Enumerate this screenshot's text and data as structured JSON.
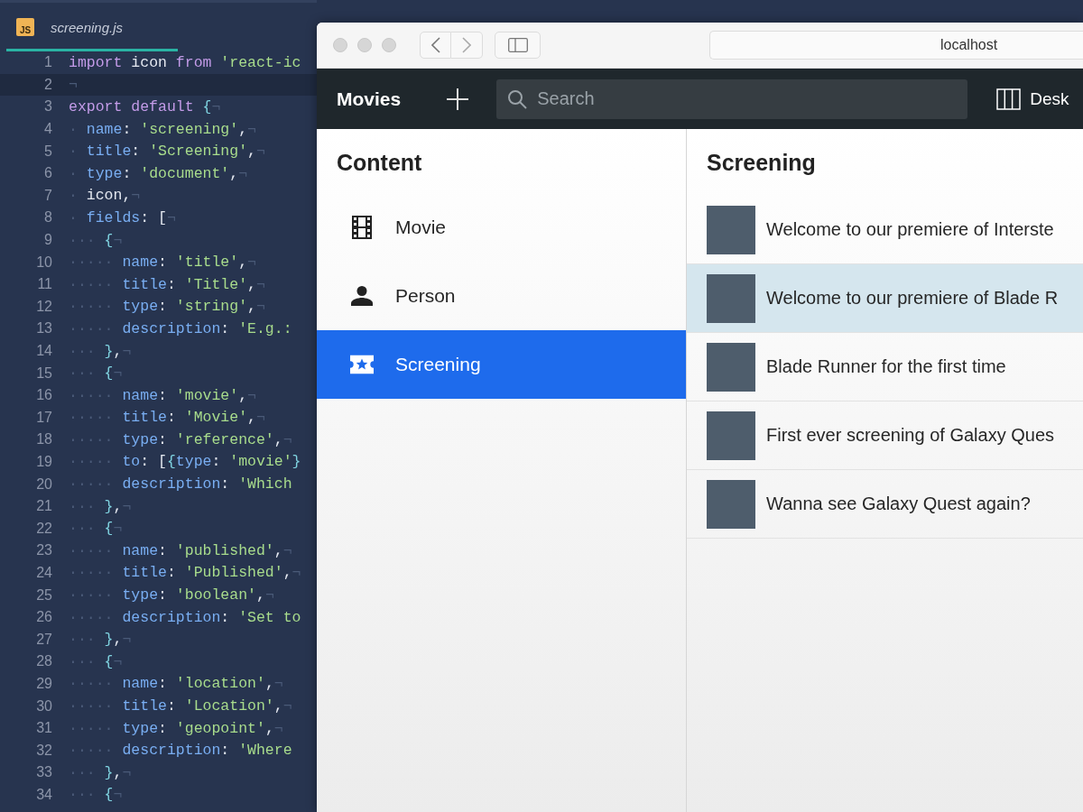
{
  "editor": {
    "tab": {
      "badge": "JS",
      "filename": "screening.js",
      "selected": true
    },
    "lines": [
      {
        "number": "1",
        "current": false,
        "tokens": [
          {
            "kind": "keyword",
            "text": "import"
          },
          {
            "kind": "plain",
            "text": " icon "
          },
          {
            "kind": "keyword",
            "text": "from"
          },
          {
            "kind": "string",
            "text": " 'react-ic"
          }
        ]
      },
      {
        "number": "2",
        "current": true,
        "tokens": [
          {
            "kind": "mark",
            "text": "¬"
          }
        ]
      },
      {
        "number": "3",
        "current": false,
        "tokens": [
          {
            "kind": "keyword",
            "text": "export default"
          },
          {
            "kind": "punct",
            "text": " {"
          },
          {
            "kind": "mark",
            "text": "¬"
          }
        ]
      },
      {
        "number": "4",
        "current": false,
        "tokens": [
          {
            "kind": "mark",
            "text": "· "
          },
          {
            "kind": "property",
            "text": "name"
          },
          {
            "kind": "plain",
            "text": ": "
          },
          {
            "kind": "string",
            "text": "'screening'"
          },
          {
            "kind": "plain",
            "text": ","
          },
          {
            "kind": "mark",
            "text": "¬"
          }
        ]
      },
      {
        "number": "5",
        "current": false,
        "tokens": [
          {
            "kind": "mark",
            "text": "· "
          },
          {
            "kind": "property",
            "text": "title"
          },
          {
            "kind": "plain",
            "text": ": "
          },
          {
            "kind": "string",
            "text": "'Screening'"
          },
          {
            "kind": "plain",
            "text": ","
          },
          {
            "kind": "mark",
            "text": "¬"
          }
        ]
      },
      {
        "number": "6",
        "current": false,
        "tokens": [
          {
            "kind": "mark",
            "text": "· "
          },
          {
            "kind": "property",
            "text": "type"
          },
          {
            "kind": "plain",
            "text": ": "
          },
          {
            "kind": "string",
            "text": "'document'"
          },
          {
            "kind": "plain",
            "text": ","
          },
          {
            "kind": "mark",
            "text": "¬"
          }
        ]
      },
      {
        "number": "7",
        "current": false,
        "tokens": [
          {
            "kind": "mark",
            "text": "· "
          },
          {
            "kind": "plain",
            "text": "icon,"
          },
          {
            "kind": "mark",
            "text": "¬"
          }
        ]
      },
      {
        "number": "8",
        "current": false,
        "tokens": [
          {
            "kind": "mark",
            "text": "· "
          },
          {
            "kind": "property",
            "text": "fields"
          },
          {
            "kind": "plain",
            "text": ": ["
          },
          {
            "kind": "mark",
            "text": "¬"
          }
        ]
      },
      {
        "number": "9",
        "current": false,
        "tokens": [
          {
            "kind": "mark",
            "text": "··· "
          },
          {
            "kind": "punct",
            "text": "{"
          },
          {
            "kind": "mark",
            "text": "¬"
          }
        ]
      },
      {
        "number": "10",
        "current": false,
        "tokens": [
          {
            "kind": "mark",
            "text": "····· "
          },
          {
            "kind": "property",
            "text": "name"
          },
          {
            "kind": "plain",
            "text": ": "
          },
          {
            "kind": "string",
            "text": "'title'"
          },
          {
            "kind": "plain",
            "text": ","
          },
          {
            "kind": "mark",
            "text": "¬"
          }
        ]
      },
      {
        "number": "11",
        "current": false,
        "tokens": [
          {
            "kind": "mark",
            "text": "····· "
          },
          {
            "kind": "property",
            "text": "title"
          },
          {
            "kind": "plain",
            "text": ": "
          },
          {
            "kind": "string",
            "text": "'Title'"
          },
          {
            "kind": "plain",
            "text": ","
          },
          {
            "kind": "mark",
            "text": "¬"
          }
        ]
      },
      {
        "number": "12",
        "current": false,
        "tokens": [
          {
            "kind": "mark",
            "text": "····· "
          },
          {
            "kind": "property",
            "text": "type"
          },
          {
            "kind": "plain",
            "text": ": "
          },
          {
            "kind": "string",
            "text": "'string'"
          },
          {
            "kind": "plain",
            "text": ","
          },
          {
            "kind": "mark",
            "text": "¬"
          }
        ]
      },
      {
        "number": "13",
        "current": false,
        "tokens": [
          {
            "kind": "mark",
            "text": "····· "
          },
          {
            "kind": "property",
            "text": "description"
          },
          {
            "kind": "plain",
            "text": ": "
          },
          {
            "kind": "string",
            "text": "'E.g.:"
          }
        ]
      },
      {
        "number": "14",
        "current": false,
        "tokens": [
          {
            "kind": "mark",
            "text": "··· "
          },
          {
            "kind": "punct",
            "text": "}"
          },
          {
            "kind": "plain",
            "text": ","
          },
          {
            "kind": "mark",
            "text": "¬"
          }
        ]
      },
      {
        "number": "15",
        "current": false,
        "tokens": [
          {
            "kind": "mark",
            "text": "··· "
          },
          {
            "kind": "punct",
            "text": "{"
          },
          {
            "kind": "mark",
            "text": "¬"
          }
        ]
      },
      {
        "number": "16",
        "current": false,
        "tokens": [
          {
            "kind": "mark",
            "text": "····· "
          },
          {
            "kind": "property",
            "text": "name"
          },
          {
            "kind": "plain",
            "text": ": "
          },
          {
            "kind": "string",
            "text": "'movie'"
          },
          {
            "kind": "plain",
            "text": ","
          },
          {
            "kind": "mark",
            "text": "¬"
          }
        ]
      },
      {
        "number": "17",
        "current": false,
        "tokens": [
          {
            "kind": "mark",
            "text": "····· "
          },
          {
            "kind": "property",
            "text": "title"
          },
          {
            "kind": "plain",
            "text": ": "
          },
          {
            "kind": "string",
            "text": "'Movie'"
          },
          {
            "kind": "plain",
            "text": ","
          },
          {
            "kind": "mark",
            "text": "¬"
          }
        ]
      },
      {
        "number": "18",
        "current": false,
        "tokens": [
          {
            "kind": "mark",
            "text": "····· "
          },
          {
            "kind": "property",
            "text": "type"
          },
          {
            "kind": "plain",
            "text": ": "
          },
          {
            "kind": "string",
            "text": "'reference'"
          },
          {
            "kind": "plain",
            "text": ","
          },
          {
            "kind": "mark",
            "text": "¬"
          }
        ]
      },
      {
        "number": "19",
        "current": false,
        "tokens": [
          {
            "kind": "mark",
            "text": "····· "
          },
          {
            "kind": "property",
            "text": "to"
          },
          {
            "kind": "plain",
            "text": ": ["
          },
          {
            "kind": "punct",
            "text": "{"
          },
          {
            "kind": "property",
            "text": "type"
          },
          {
            "kind": "plain",
            "text": ": "
          },
          {
            "kind": "string",
            "text": "'movie'"
          },
          {
            "kind": "punct",
            "text": "}"
          }
        ]
      },
      {
        "number": "20",
        "current": false,
        "tokens": [
          {
            "kind": "mark",
            "text": "····· "
          },
          {
            "kind": "property",
            "text": "description"
          },
          {
            "kind": "plain",
            "text": ": "
          },
          {
            "kind": "string",
            "text": "'Which"
          }
        ]
      },
      {
        "number": "21",
        "current": false,
        "tokens": [
          {
            "kind": "mark",
            "text": "··· "
          },
          {
            "kind": "punct",
            "text": "}"
          },
          {
            "kind": "plain",
            "text": ","
          },
          {
            "kind": "mark",
            "text": "¬"
          }
        ]
      },
      {
        "number": "22",
        "current": false,
        "tokens": [
          {
            "kind": "mark",
            "text": "··· "
          },
          {
            "kind": "punct",
            "text": "{"
          },
          {
            "kind": "mark",
            "text": "¬"
          }
        ]
      },
      {
        "number": "23",
        "current": false,
        "tokens": [
          {
            "kind": "mark",
            "text": "····· "
          },
          {
            "kind": "property",
            "text": "name"
          },
          {
            "kind": "plain",
            "text": ": "
          },
          {
            "kind": "string",
            "text": "'published'"
          },
          {
            "kind": "plain",
            "text": ","
          },
          {
            "kind": "mark",
            "text": "¬"
          }
        ]
      },
      {
        "number": "24",
        "current": false,
        "tokens": [
          {
            "kind": "mark",
            "text": "····· "
          },
          {
            "kind": "property",
            "text": "title"
          },
          {
            "kind": "plain",
            "text": ": "
          },
          {
            "kind": "string",
            "text": "'Published'"
          },
          {
            "kind": "plain",
            "text": ","
          },
          {
            "kind": "mark",
            "text": "¬"
          }
        ]
      },
      {
        "number": "25",
        "current": false,
        "tokens": [
          {
            "kind": "mark",
            "text": "····· "
          },
          {
            "kind": "property",
            "text": "type"
          },
          {
            "kind": "plain",
            "text": ": "
          },
          {
            "kind": "string",
            "text": "'boolean'"
          },
          {
            "kind": "plain",
            "text": ","
          },
          {
            "kind": "mark",
            "text": "¬"
          }
        ]
      },
      {
        "number": "26",
        "current": false,
        "tokens": [
          {
            "kind": "mark",
            "text": "····· "
          },
          {
            "kind": "property",
            "text": "description"
          },
          {
            "kind": "plain",
            "text": ": "
          },
          {
            "kind": "string",
            "text": "'Set to"
          }
        ]
      },
      {
        "number": "27",
        "current": false,
        "tokens": [
          {
            "kind": "mark",
            "text": "··· "
          },
          {
            "kind": "punct",
            "text": "}"
          },
          {
            "kind": "plain",
            "text": ","
          },
          {
            "kind": "mark",
            "text": "¬"
          }
        ]
      },
      {
        "number": "28",
        "current": false,
        "tokens": [
          {
            "kind": "mark",
            "text": "··· "
          },
          {
            "kind": "punct",
            "text": "{"
          },
          {
            "kind": "mark",
            "text": "¬"
          }
        ]
      },
      {
        "number": "29",
        "current": false,
        "tokens": [
          {
            "kind": "mark",
            "text": "····· "
          },
          {
            "kind": "property",
            "text": "name"
          },
          {
            "kind": "plain",
            "text": ": "
          },
          {
            "kind": "string",
            "text": "'location'"
          },
          {
            "kind": "plain",
            "text": ","
          },
          {
            "kind": "mark",
            "text": "¬"
          }
        ]
      },
      {
        "number": "30",
        "current": false,
        "tokens": [
          {
            "kind": "mark",
            "text": "····· "
          },
          {
            "kind": "property",
            "text": "title"
          },
          {
            "kind": "plain",
            "text": ": "
          },
          {
            "kind": "string",
            "text": "'Location'"
          },
          {
            "kind": "plain",
            "text": ","
          },
          {
            "kind": "mark",
            "text": "¬"
          }
        ]
      },
      {
        "number": "31",
        "current": false,
        "tokens": [
          {
            "kind": "mark",
            "text": "····· "
          },
          {
            "kind": "property",
            "text": "type"
          },
          {
            "kind": "plain",
            "text": ": "
          },
          {
            "kind": "string",
            "text": "'geopoint'"
          },
          {
            "kind": "plain",
            "text": ","
          },
          {
            "kind": "mark",
            "text": "¬"
          }
        ]
      },
      {
        "number": "32",
        "current": false,
        "tokens": [
          {
            "kind": "mark",
            "text": "····· "
          },
          {
            "kind": "property",
            "text": "description"
          },
          {
            "kind": "plain",
            "text": ": "
          },
          {
            "kind": "string",
            "text": "'Where"
          }
        ]
      },
      {
        "number": "33",
        "current": false,
        "tokens": [
          {
            "kind": "mark",
            "text": "··· "
          },
          {
            "kind": "punct",
            "text": "}"
          },
          {
            "kind": "plain",
            "text": ","
          },
          {
            "kind": "mark",
            "text": "¬"
          }
        ]
      },
      {
        "number": "34",
        "current": false,
        "tokens": [
          {
            "kind": "mark",
            "text": "··· "
          },
          {
            "kind": "punct",
            "text": "{"
          },
          {
            "kind": "mark",
            "text": "¬"
          }
        ]
      }
    ]
  },
  "browser": {
    "url": "localhost",
    "app": {
      "title": "Movies",
      "search": {
        "placeholder": "Search"
      },
      "tool": "Desk"
    },
    "content_pane": {
      "title": "Content",
      "items": [
        {
          "label": "Movie",
          "kind": "film",
          "selected": false
        },
        {
          "label": "Person",
          "kind": "person",
          "selected": false
        },
        {
          "label": "Screening",
          "kind": "ticket",
          "selected": true
        }
      ]
    },
    "list_pane": {
      "title": "Screening",
      "items": [
        {
          "title": "Welcome to our premiere of Interste",
          "selected": false
        },
        {
          "title": "Welcome to our premiere of Blade R",
          "selected": true
        },
        {
          "title": "Blade Runner for the first time",
          "selected": false
        },
        {
          "title": "First ever screening of Galaxy Ques",
          "selected": false
        },
        {
          "title": "Wanna see Galaxy Quest again?",
          "selected": false
        }
      ]
    }
  }
}
